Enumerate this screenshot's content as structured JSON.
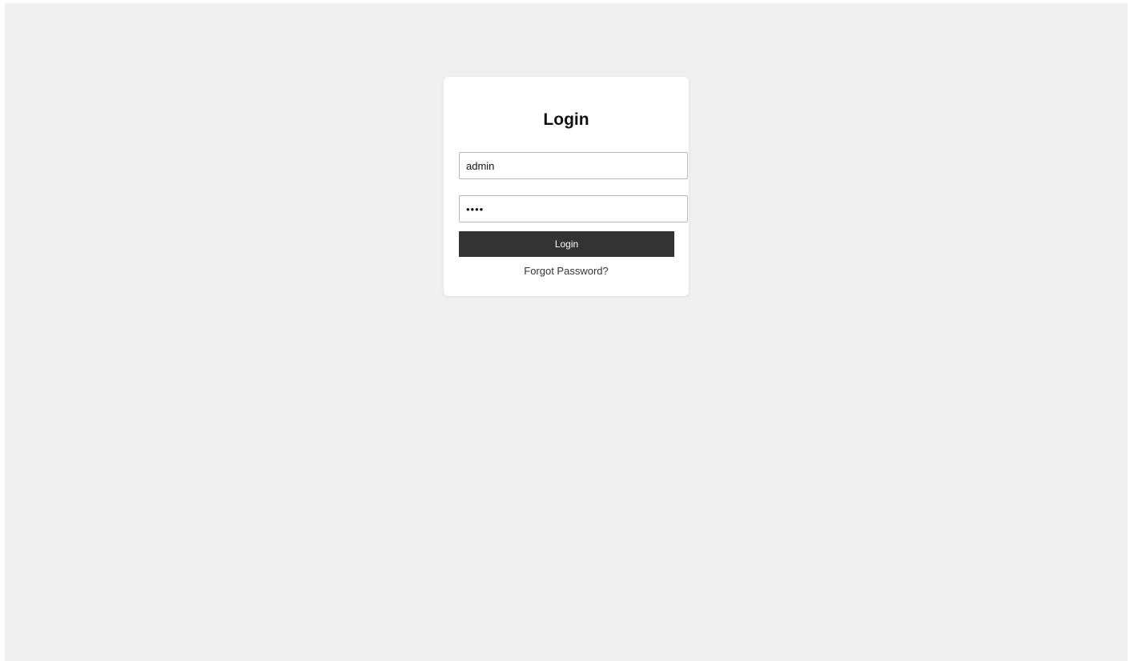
{
  "login_form": {
    "title": "Login",
    "username": {
      "value": "admin",
      "placeholder": ""
    },
    "password": {
      "value": "••••",
      "placeholder": ""
    },
    "submit_label": "Login",
    "forgot_password_label": "Forgot Password?"
  },
  "colors": {
    "page_background": "#f0f0f0",
    "card_background": "#ffffff",
    "button_background": "#333333",
    "button_text": "#ffffff"
  }
}
